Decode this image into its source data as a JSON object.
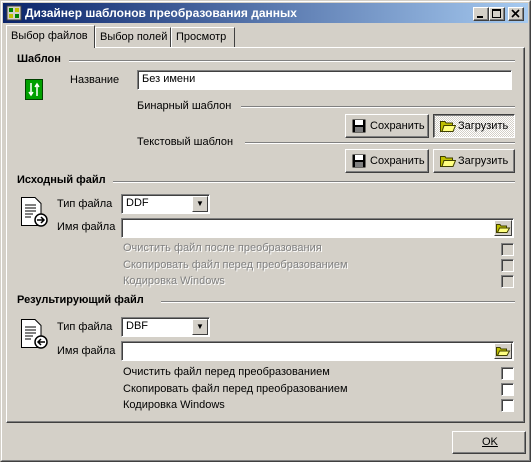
{
  "window": {
    "title": "Дизайнер шаблонов преобразования данных"
  },
  "tabs": [
    {
      "label": "Выбор файлов",
      "active": true
    },
    {
      "label": "Выбор полей",
      "active": false
    },
    {
      "label": "Просмотр",
      "active": false
    }
  ],
  "template_section": {
    "heading": "Шаблон",
    "name_label": "Название",
    "name_value": "Без имени",
    "binary_label": "Бинарный шаблон",
    "text_label": "Текстовый шаблон",
    "save_label": "Сохранить",
    "load_label": "Загрузить"
  },
  "source_section": {
    "heading": "Исходный файл",
    "file_type_label": "Тип файла",
    "file_type_value": "DDF",
    "file_name_label": "Имя файла",
    "file_name_value": "",
    "options": [
      {
        "label": "Очистить файл после преобразования",
        "checked": false,
        "enabled": false
      },
      {
        "label": "Скопировать файл перед преобразованием",
        "checked": false,
        "enabled": false
      },
      {
        "label": "Кодировка Windows",
        "checked": false,
        "enabled": false
      }
    ]
  },
  "result_section": {
    "heading": "Результирующий файл",
    "file_type_label": "Тип файла",
    "file_type_value": "DBF",
    "file_name_label": "Имя файла",
    "file_name_value": "",
    "options": [
      {
        "label": "Очистить файл перед преобразованием",
        "checked": false,
        "enabled": true
      },
      {
        "label": "Скопировать файл перед преобразованием",
        "checked": false,
        "enabled": true
      },
      {
        "label": "Кодировка Windows",
        "checked": false,
        "enabled": true
      }
    ]
  },
  "footer": {
    "ok_label": "OK"
  }
}
